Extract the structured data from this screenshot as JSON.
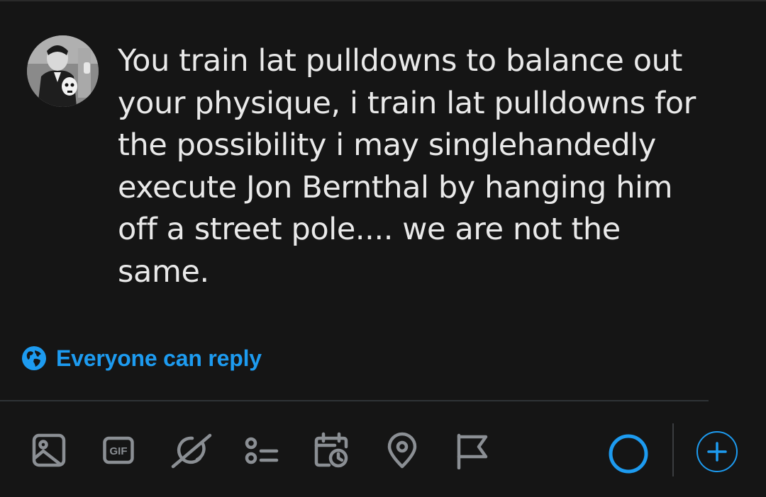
{
  "compose": {
    "avatar_icon": "user-avatar",
    "text": "You train lat pulldowns to balance out\nyour physique, i train lat pulldowns for\nthe possibility i may singlehandedly\nexecute Jon Bernthal by hanging him\noff a street pole.... we are not the\nsame."
  },
  "reply_setting": {
    "icon": "globe-icon",
    "label": "Everyone can reply"
  },
  "toolbar": {
    "icons": [
      "image-icon",
      "gif-icon",
      "grok-icon",
      "poll-icon",
      "schedule-icon",
      "location-icon",
      "flag-icon"
    ],
    "gif_label": "GIF"
  },
  "char_progress": 0,
  "colors": {
    "accent": "#1d9bf0",
    "icon": "#8b8f94",
    "background": "#151515"
  }
}
